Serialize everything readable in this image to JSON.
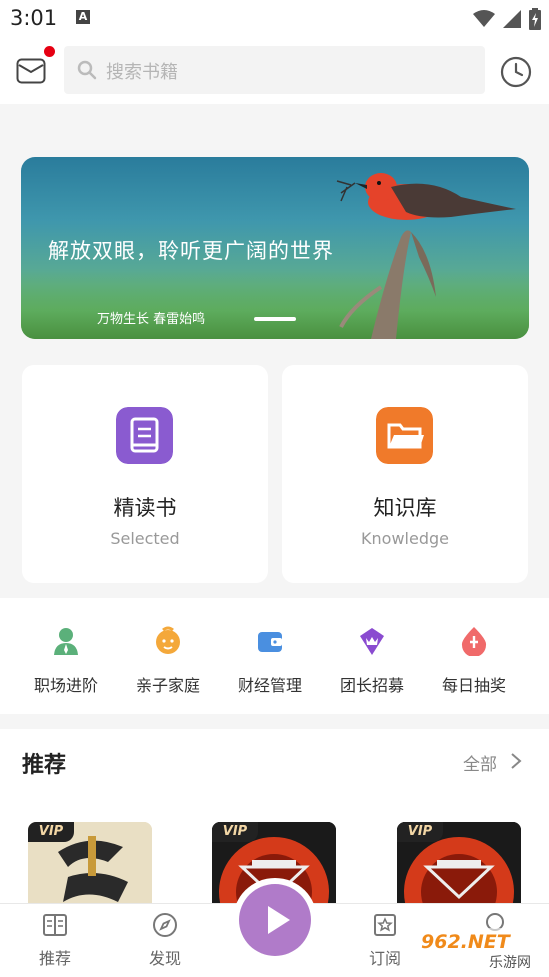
{
  "status_bar": {
    "time": "3:01",
    "a_icon": "A",
    "icons": [
      "wifi-icon",
      "signal-icon",
      "battery-icon"
    ]
  },
  "header": {
    "search_placeholder": "搜索书籍",
    "icons": [
      "mail-icon",
      "search-icon",
      "history-icon"
    ],
    "notification_dot_color": "#e60012"
  },
  "banner": {
    "title": "解放双眼，聆听更广阔的世界",
    "subtitle": "万物生长  春雷始鸣"
  },
  "cards": [
    {
      "title": "精读书",
      "subtitle": "Selected",
      "icon": "book-icon",
      "color": "#8a5bd0"
    },
    {
      "title": "知识库",
      "subtitle": "Knowledge",
      "icon": "folder-icon",
      "color": "#f07a2a"
    }
  ],
  "categories": [
    {
      "label": "职场进阶",
      "icon": "career-icon",
      "color": "#5bb07a"
    },
    {
      "label": "亲子家庭",
      "icon": "family-icon",
      "color": "#f4a83a"
    },
    {
      "label": "财经管理",
      "icon": "wallet-icon",
      "color": "#4a8fe0"
    },
    {
      "label": "团长招募",
      "icon": "crown-icon",
      "color": "#8a4bd0"
    },
    {
      "label": "每日抽奖",
      "icon": "lottery-icon",
      "color": "#f06a6a"
    }
  ],
  "recommend": {
    "title": "推荐",
    "all_label": "全部",
    "badge": "VIP",
    "books": [
      {
        "cover_colors": [
          "#e8dcc0",
          "#2a2a2a"
        ]
      },
      {
        "cover_colors": [
          "#1a1a1a",
          "#d43a1a"
        ]
      },
      {
        "cover_colors": [
          "#1a1a1a",
          "#d43a1a"
        ]
      }
    ]
  },
  "tabbar": {
    "tabs": [
      {
        "label": "推荐",
        "icon": "book-open-icon"
      },
      {
        "label": "发现",
        "icon": "compass-icon"
      },
      {
        "label": "订阅",
        "icon": "star-card-icon"
      },
      {
        "label": "",
        "icon": "profile-icon"
      }
    ],
    "play_color": "#b07bc9"
  },
  "watermark": {
    "top": "962.NET",
    "bottom": "乐游网"
  }
}
